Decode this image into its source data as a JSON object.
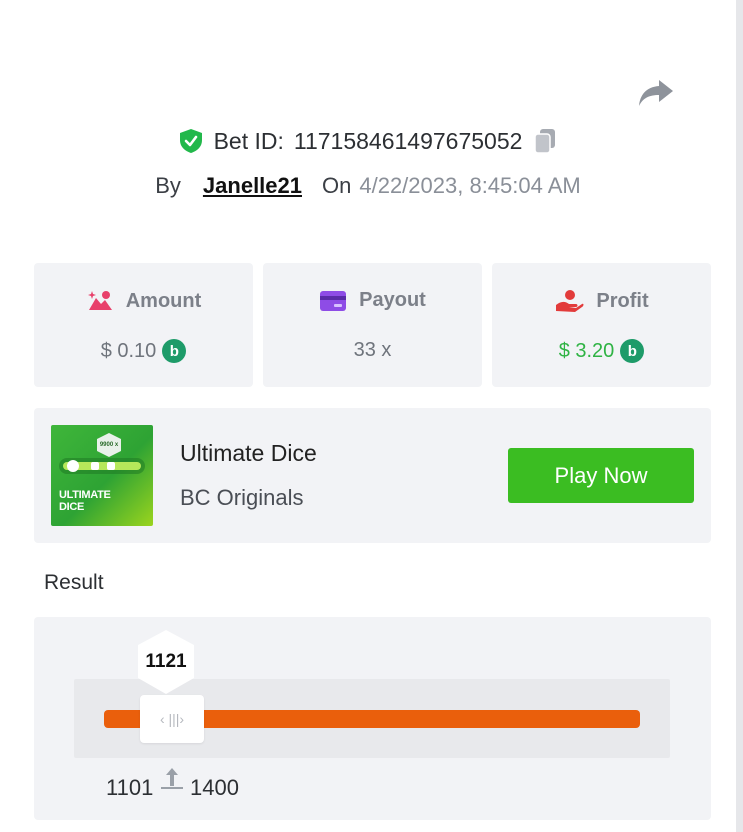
{
  "header": {
    "bet_id_label": "Bet ID:",
    "bet_id": "117158461497675052",
    "by_label": "By",
    "username": "Janelle21",
    "on_label": "On",
    "datetime": "4/22/2023, 8:45:04 AM"
  },
  "stats": {
    "amount": {
      "label": "Amount",
      "value": "$ 0.10"
    },
    "payout": {
      "label": "Payout",
      "value": "33 x"
    },
    "profit": {
      "label": "Profit",
      "value": "$ 3.20"
    }
  },
  "game": {
    "title": "Ultimate Dice",
    "provider": "BC Originals",
    "play_label": "Play Now",
    "thumb_text_line1": "ULTIMATE",
    "thumb_text_line2": "DICE",
    "thumb_badge": "9900 x"
  },
  "result": {
    "label": "Result",
    "value": "1121",
    "range_low": "1101",
    "range_high": "1400"
  },
  "colors": {
    "accent_green": "#3bbd22",
    "profit_green": "#2fb344",
    "bar_orange": "#ea5f0c",
    "coin_green": "#1e9b69"
  },
  "icons": [
    "share-icon",
    "verified-shield-icon",
    "copy-icon",
    "amount-icon",
    "payout-card-icon",
    "profit-hand-icon",
    "currency-coin-icon",
    "slider-arrows-icon",
    "swap-range-icon"
  ]
}
